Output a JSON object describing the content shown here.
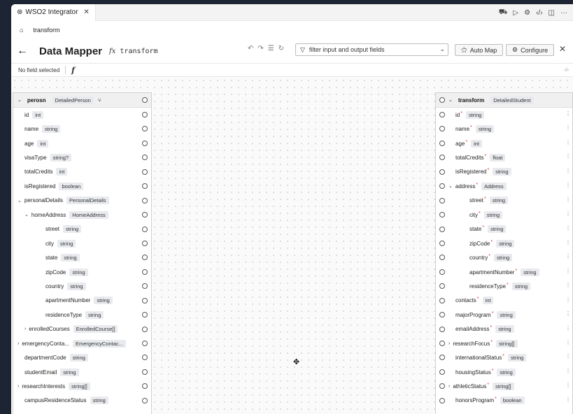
{
  "tab": {
    "title": "WSO2 Integrator"
  },
  "breadcrumb": {
    "label": "transform"
  },
  "header": {
    "title": "Data Mapper",
    "fx": "fx",
    "fn_name": "transform",
    "filter_placeholder": "filter input and output fields",
    "auto_map": "Auto Map",
    "configure": "Configure"
  },
  "subbar": {
    "status": "No field selected",
    "fx_symbol": "f"
  },
  "source": {
    "name": "perosn",
    "type": "DetailedPerson",
    "rows": [
      {
        "name": "id",
        "type": "int",
        "indent": 0
      },
      {
        "name": "name",
        "type": "string",
        "indent": 0
      },
      {
        "name": "age",
        "type": "int",
        "indent": 0
      },
      {
        "name": "visaType",
        "type": "string?",
        "indent": 0
      },
      {
        "name": "totalCredits",
        "type": "int",
        "indent": 0
      },
      {
        "name": "isRegistered",
        "type": "boolean",
        "indent": 0
      },
      {
        "name": "personalDetails",
        "type": "PersonalDetails",
        "indent": 0,
        "chev": "v"
      },
      {
        "name": "homeAddress",
        "type": "HomeAddress",
        "indent": 1,
        "chev": "v"
      },
      {
        "name": "street",
        "type": "string",
        "indent": 3
      },
      {
        "name": "city",
        "type": "string",
        "indent": 3
      },
      {
        "name": "state",
        "type": "string",
        "indent": 3
      },
      {
        "name": "zipCode",
        "type": "string",
        "indent": 3
      },
      {
        "name": "country",
        "type": "string",
        "indent": 3
      },
      {
        "name": "apartmentNumber",
        "type": "string",
        "indent": 3
      },
      {
        "name": "residenceType",
        "type": "string",
        "indent": 3
      },
      {
        "name": "enrolledCourses",
        "type": "EnrolledCourse[]",
        "indent": 1,
        "chev": ">"
      },
      {
        "name": "emergencyConta...",
        "type": "EmergencyContac...",
        "indent": 0,
        "chev": ">"
      },
      {
        "name": "departmentCode",
        "type": "string",
        "indent": 0
      },
      {
        "name": "studentEmail",
        "type": "string",
        "indent": 0
      },
      {
        "name": "researchInterests",
        "type": "string[]",
        "indent": 0,
        "chev": ">"
      },
      {
        "name": "campusResidenceStatus",
        "type": "string",
        "indent": 0
      }
    ]
  },
  "target": {
    "name": "transform",
    "type": "DetailedStudent",
    "rows": [
      {
        "name": "id",
        "type": "string",
        "indent": 0
      },
      {
        "name": "name",
        "type": "string",
        "indent": 0
      },
      {
        "name": "age",
        "type": "int",
        "indent": 0
      },
      {
        "name": "totalCredits",
        "type": "float",
        "indent": 0
      },
      {
        "name": "isRegistered",
        "type": "string",
        "indent": 0
      },
      {
        "name": "address",
        "type": "Address",
        "indent": 0,
        "chev": "v"
      },
      {
        "name": "street",
        "type": "string",
        "indent": 2
      },
      {
        "name": "city",
        "type": "string",
        "indent": 2
      },
      {
        "name": "state",
        "type": "string",
        "indent": 2
      },
      {
        "name": "zipCode",
        "type": "string",
        "indent": 2
      },
      {
        "name": "country",
        "type": "string",
        "indent": 2
      },
      {
        "name": "apartmentNumber",
        "type": "string",
        "indent": 2
      },
      {
        "name": "residenceType",
        "type": "string",
        "indent": 2
      },
      {
        "name": "contacts",
        "type": "int",
        "indent": 0
      },
      {
        "name": "majorProgram",
        "type": "string",
        "indent": 0
      },
      {
        "name": "emailAddress",
        "type": "string",
        "indent": 0
      },
      {
        "name": "researchFocus",
        "type": "string[]",
        "indent": 0,
        "chev": ">"
      },
      {
        "name": "internationalStatus",
        "type": "string",
        "indent": 0
      },
      {
        "name": "housingStatus",
        "type": "string",
        "indent": 0
      },
      {
        "name": "athleticStatus",
        "type": "string[]",
        "indent": 0,
        "chev": ">"
      },
      {
        "name": "honorsProgram",
        "type": "boolean",
        "indent": 0
      }
    ]
  }
}
